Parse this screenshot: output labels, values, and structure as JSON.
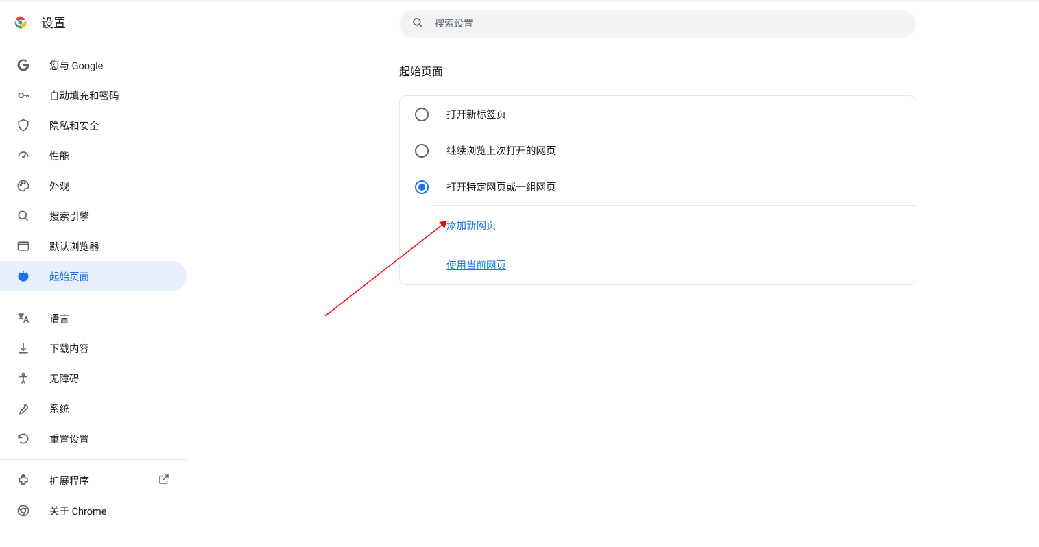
{
  "header": {
    "title": "设置",
    "search_placeholder": "搜索设置"
  },
  "sidebar": {
    "items": [
      {
        "id": "you-and-google",
        "label": "您与 Google",
        "icon": "google"
      },
      {
        "id": "autofill",
        "label": "自动填充和密码",
        "icon": "key"
      },
      {
        "id": "privacy",
        "label": "隐私和安全",
        "icon": "shield"
      },
      {
        "id": "performance",
        "label": "性能",
        "icon": "speed"
      },
      {
        "id": "appearance",
        "label": "外观",
        "icon": "palette"
      },
      {
        "id": "search-engine",
        "label": "搜索引擎",
        "icon": "search"
      },
      {
        "id": "default-browser",
        "label": "默认浏览器",
        "icon": "browser"
      },
      {
        "id": "on-startup",
        "label": "起始页面",
        "icon": "power",
        "active": true
      }
    ],
    "items2": [
      {
        "id": "languages",
        "label": "语言",
        "icon": "translate"
      },
      {
        "id": "downloads",
        "label": "下载内容",
        "icon": "download"
      },
      {
        "id": "accessibility",
        "label": "无障碍",
        "icon": "accessibility"
      },
      {
        "id": "system",
        "label": "系统",
        "icon": "wrench"
      },
      {
        "id": "reset",
        "label": "重置设置",
        "icon": "reset"
      }
    ],
    "items3": [
      {
        "id": "extensions",
        "label": "扩展程序",
        "icon": "extension",
        "external": true
      },
      {
        "id": "about",
        "label": "关于 Chrome",
        "icon": "chrome"
      }
    ]
  },
  "main": {
    "section_title": "起始页面",
    "options": [
      {
        "id": "new-tab",
        "label": "打开新标签页",
        "checked": false
      },
      {
        "id": "continue",
        "label": "继续浏览上次打开的网页",
        "checked": false
      },
      {
        "id": "specific",
        "label": "打开特定网页或一组网页",
        "checked": true
      }
    ],
    "add_page_label": "添加新网页",
    "use_current_label": "使用当前网页"
  }
}
